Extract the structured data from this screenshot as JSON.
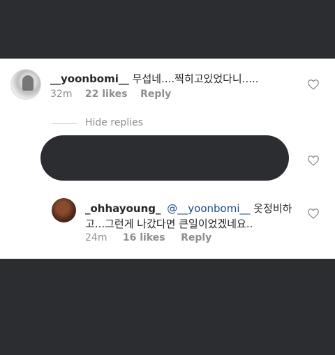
{
  "comments": [
    {
      "username": "__yoonbomi__",
      "text": " 무섭네....찍히고있었다니.....",
      "time": "32m",
      "likes": "22 likes",
      "reply": "Reply"
    },
    {
      "username": "_ohhayoung_",
      "mention": "@__yoonbomi__",
      "text_line1": " 옷정비하",
      "text_line2": "고...그런게 나갔다면 큰일이었겠네요..",
      "time": "24m",
      "likes": "16 likes",
      "reply": "Reply"
    }
  ],
  "hide_replies": "Hide replies",
  "colors": {
    "background": "#2b2d31",
    "panel": "#ffffff",
    "text": "#262626",
    "meta": "#8e8e8e",
    "mention": "#1b4b86"
  },
  "icons": [
    "heart-icon",
    "heart-icon",
    "heart-icon"
  ]
}
